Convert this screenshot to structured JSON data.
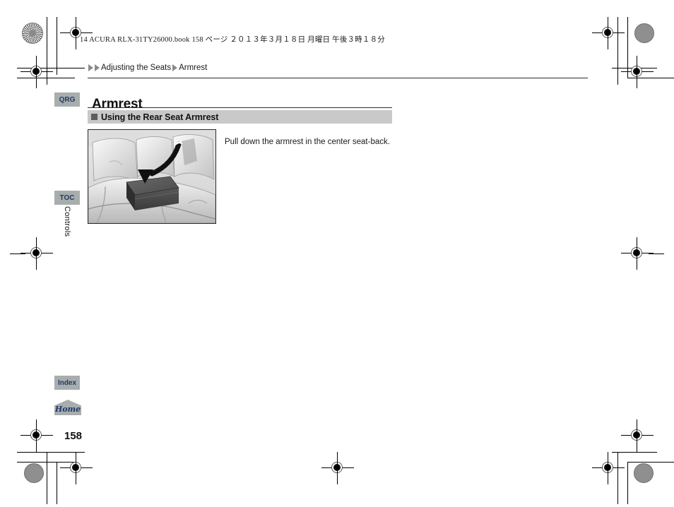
{
  "print_header": {
    "text": "14 ACURA RLX-31TY26000.book   158 ページ   ２０１３年３月１８日   月曜日   午後３時１８分"
  },
  "breadcrumb": {
    "arrow_icon": "triangle-right-icon",
    "parent": "Adjusting the Seats",
    "current": "Armrest"
  },
  "page": {
    "title": "Armrest",
    "number": "158",
    "chapter": "Controls"
  },
  "section": {
    "bullet_icon": "square-bullet-icon",
    "heading": "Using the Rear Seat Armrest"
  },
  "body": {
    "paragraph": "Pull down the armrest in the center seat-back."
  },
  "figure": {
    "name": "rear-seat-armrest-illustration",
    "description": "Rear bench seat with center armrest folded down, curved arrow indicating downward pull motion",
    "arrow_icon": "curved-down-arrow-icon"
  },
  "side_tabs": [
    {
      "id": "qrg",
      "label": "QRG"
    },
    {
      "id": "toc",
      "label": "TOC"
    },
    {
      "id": "index",
      "label": "Index"
    },
    {
      "id": "home",
      "label": "Home"
    }
  ],
  "colors": {
    "tab_background": "#a8adad",
    "tab_text": "#1f3a68",
    "banner_background": "#c9c9c9",
    "bullet": "#5d5d5d",
    "rule": "#2b2b2b",
    "breadcrumb_arrow": "#8a8a8a"
  },
  "print_marks": {
    "registration_icon": "registration-crosshair-icon",
    "rosette_icon": "color-rosette-icon",
    "density_icon": "density-blob-icon",
    "crop_icon": "crop-mark-icon"
  }
}
